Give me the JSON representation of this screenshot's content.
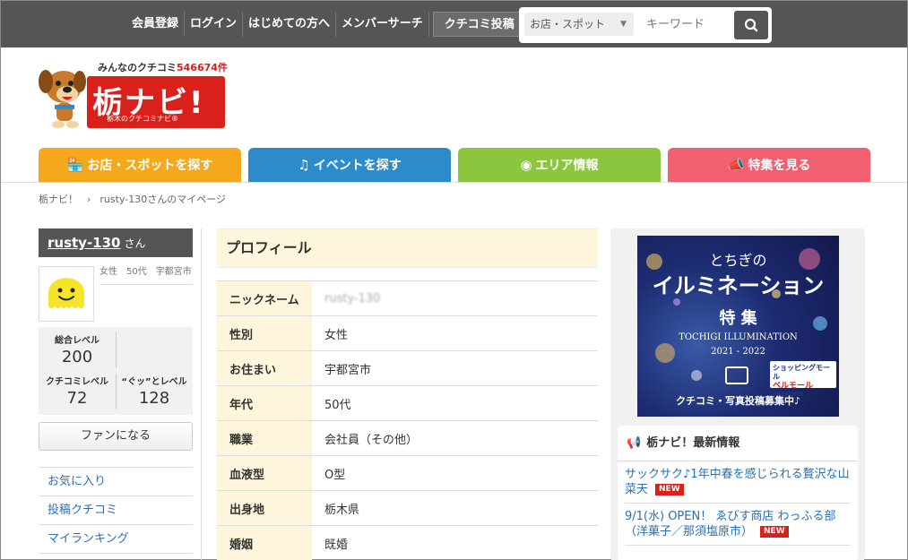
{
  "topnav": {
    "items": [
      "会員登録",
      "ログイン",
      "はじめての方へ",
      "メンバーサーチ"
    ],
    "post_label": "クチコミ投稿"
  },
  "search": {
    "category": "お店・スポット",
    "placeholder": "キーワード"
  },
  "logo": {
    "tagline_prefix": "みんなのクチコミ",
    "count": "546674件",
    "wordmark": "栃ナビ!",
    "subtitle": "栃木のクチコミナビ®"
  },
  "tabs": [
    {
      "label": "お店・スポットを探す",
      "color": "#f5a81c",
      "icon": "store-icon"
    },
    {
      "label": "イベントを探す",
      "color": "#2c8ccb",
      "icon": "music-note-icon"
    },
    {
      "label": "エリア情報",
      "color": "#8cc63f",
      "icon": "compass-icon"
    },
    {
      "label": "特集を見る",
      "color": "#f06070",
      "icon": "megaphone-icon"
    }
  ],
  "breadcrumb": {
    "home": "栃ナビ！",
    "sep": "›",
    "current": "rusty-130さんのマイページ"
  },
  "user": {
    "name": "rusty-130",
    "honorific": "さん",
    "meta": "女性　50代　宇都宮市",
    "levels": {
      "total_label": "総合レベル",
      "total": "200",
      "review_label": "クチコミレベル",
      "review": "72",
      "good_label": "“ぐッ”とレベル",
      "good": "128"
    },
    "fan_button": "ファンになる",
    "menu": [
      "お気に入り",
      "投稿クチコミ",
      "マイランキング"
    ]
  },
  "profile": {
    "heading": "プロフィール",
    "rows": [
      {
        "key": "ニックネーム",
        "value": "rusty-130",
        "blurred": true
      },
      {
        "key": "性別",
        "value": "女性"
      },
      {
        "key": "お住まい",
        "value": "宇都宮市"
      },
      {
        "key": "年代",
        "value": "50代"
      },
      {
        "key": "職業",
        "value": "会社員（その他）"
      },
      {
        "key": "血液型",
        "value": "O型"
      },
      {
        "key": "出身地",
        "value": "栃木県"
      },
      {
        "key": "婚姻",
        "value": "既婚"
      }
    ]
  },
  "banner": {
    "line1": "とちぎの",
    "line2": "イルミネーション",
    "line3": "特 集",
    "en": "TOCHIGI ILLUMINATION",
    "years": "2021 - 2022",
    "sponsor_top": "ショッピングモール",
    "sponsor": "ベルモール",
    "presents": "PRESENTS",
    "footer": "クチコミ・写真投稿募集中♪"
  },
  "news": {
    "heading": "栃ナビ！最新情報",
    "badge": "NEW",
    "items": [
      "サックサク♪1年中春を感じられる贅沢な山菜天",
      "9/1(水) OPEN！ ゑびす商店 わっふる部（洋菓子／那須塩原市）"
    ]
  }
}
